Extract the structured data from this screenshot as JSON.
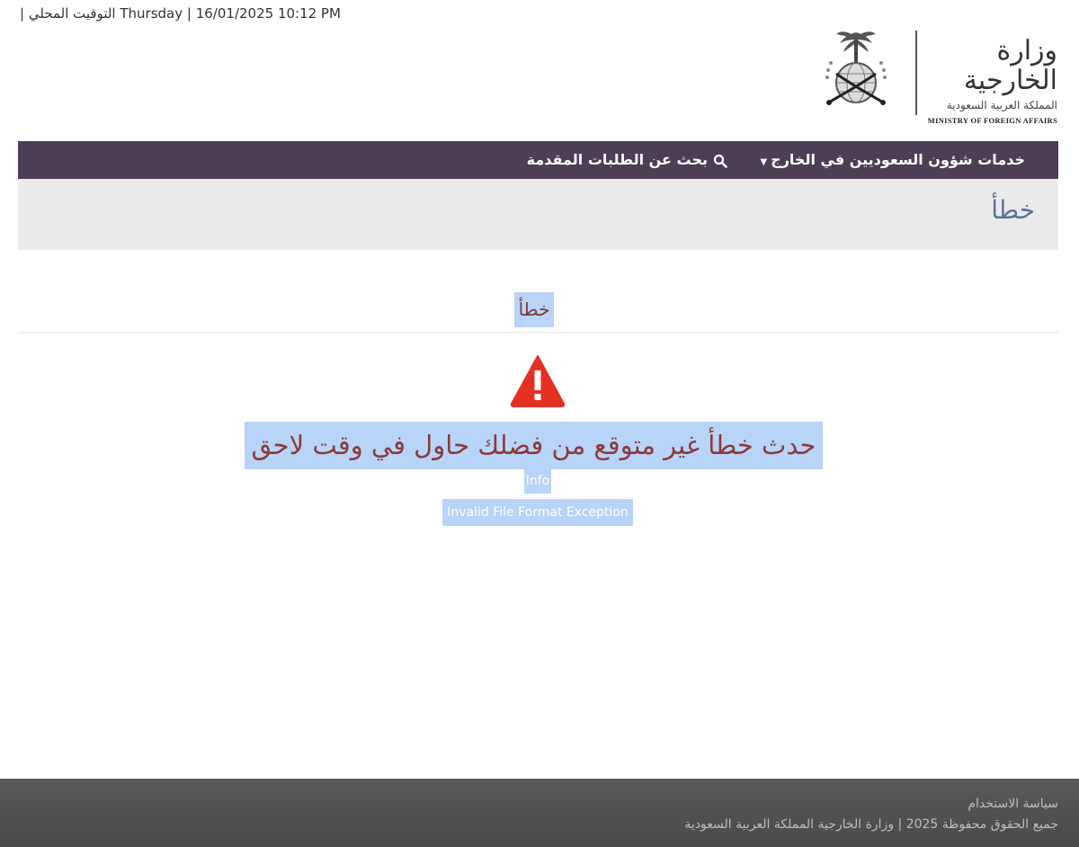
{
  "header": {
    "datetime_text": "| التوقيت المحلي Thursday | 16/01/2025 10:12 PM",
    "logo": {
      "title_ar": "وزارة الخارجية",
      "subtitle_ar": "المملكة العربية السعودية",
      "title_en": "MINISTRY OF FOREIGN AFFAIRS",
      "emblem_icon": "saudi-emblem-icon"
    }
  },
  "nav": {
    "services_label": "خدمات شؤون السعوديين في الخارج",
    "search_label": "بحث عن الطلبات المقدمة",
    "background_color": "#4d3d55"
  },
  "page": {
    "title": "خطأ"
  },
  "error": {
    "heading": "خطأ",
    "warning_icon": "warning-triangle-icon",
    "warning_color": "#e53124",
    "message": "حدث خطأ غير متوقع من فضلك حاول في وقت لاحق",
    "info_label": "Info",
    "exception_text": "Invalid File Format Exception"
  },
  "footer": {
    "terms_link": "سياسة الاستخدام",
    "copyright": "جميع الحقوق محفوظة 2025 | وزارة الخارجية المملكة العربية السعودية"
  }
}
